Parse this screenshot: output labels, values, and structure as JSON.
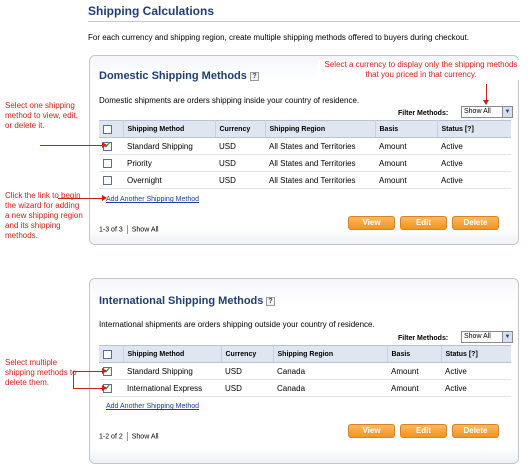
{
  "page": {
    "title": "Shipping Calculations",
    "intro": "For each currency and shipping region, create multiple shipping methods offered to buyers during checkout."
  },
  "callouts": {
    "filter": "Select a currency to display only the shipping methods that you priced in that currency.",
    "select_one": "Select one shipping method to view, edit, or delete it.",
    "click_link": "Click the link to begin the wizard for adding a new shipping region and its shipping methods.",
    "select_multiple": "Select multiple shipping methods to delete them."
  },
  "domestic": {
    "title": "Domestic Shipping Methods",
    "help": "?",
    "description": "Domestic shipments are orders shipping inside your country of residence.",
    "filter_label": "Filter Methods:",
    "filter_value": "Show All",
    "columns": [
      "",
      "Shipping Method",
      "Currency",
      "Shipping Region",
      "Basis",
      "Status [?]"
    ],
    "rows": [
      {
        "checked": true,
        "method": "Standard Shipping",
        "currency": "USD",
        "region": "All States and Territories",
        "basis": "Amount",
        "status": "Active"
      },
      {
        "checked": false,
        "method": "Priority",
        "currency": "USD",
        "region": "All States and Territories",
        "basis": "Amount",
        "status": "Active"
      },
      {
        "checked": false,
        "method": "Overnight",
        "currency": "USD",
        "region": "All States and Territories",
        "basis": "Amount",
        "status": "Active"
      }
    ],
    "add_link": "Add Another Shipping Method",
    "pager_count": "1-3 of 3",
    "pager_show_all": "Show All",
    "buttons": {
      "view": "View",
      "edit": "Edit",
      "delete": "Delete"
    }
  },
  "international": {
    "title": "International Shipping Methods",
    "help": "?",
    "description": "International shipments are orders shipping outside your country of residence.",
    "filter_label": "Filter Methods:",
    "filter_value": "Show All",
    "columns": [
      "",
      "Shipping Method",
      "Currency",
      "Shipping Region",
      "Basis",
      "Status [?]"
    ],
    "rows": [
      {
        "checked": true,
        "method": "Standard Shipping",
        "currency": "USD",
        "region": "Canada",
        "basis": "Amount",
        "status": "Active"
      },
      {
        "checked": true,
        "method": "International Express",
        "currency": "USD",
        "region": "Canada",
        "basis": "Amount",
        "status": "Active"
      }
    ],
    "add_link": "Add Another Shipping Method",
    "pager_count": "1-2 of 2",
    "pager_show_all": "Show All",
    "buttons": {
      "view": "View",
      "edit": "Edit",
      "delete": "Delete"
    }
  },
  "colors": {
    "heading": "#1f3f70",
    "callout": "#d0201a",
    "button": "#f3931f",
    "link": "#1a3fa0"
  },
  "icons": {
    "checked": "check-icon",
    "help": "help-icon",
    "dropdown": "chevron-down-icon"
  }
}
